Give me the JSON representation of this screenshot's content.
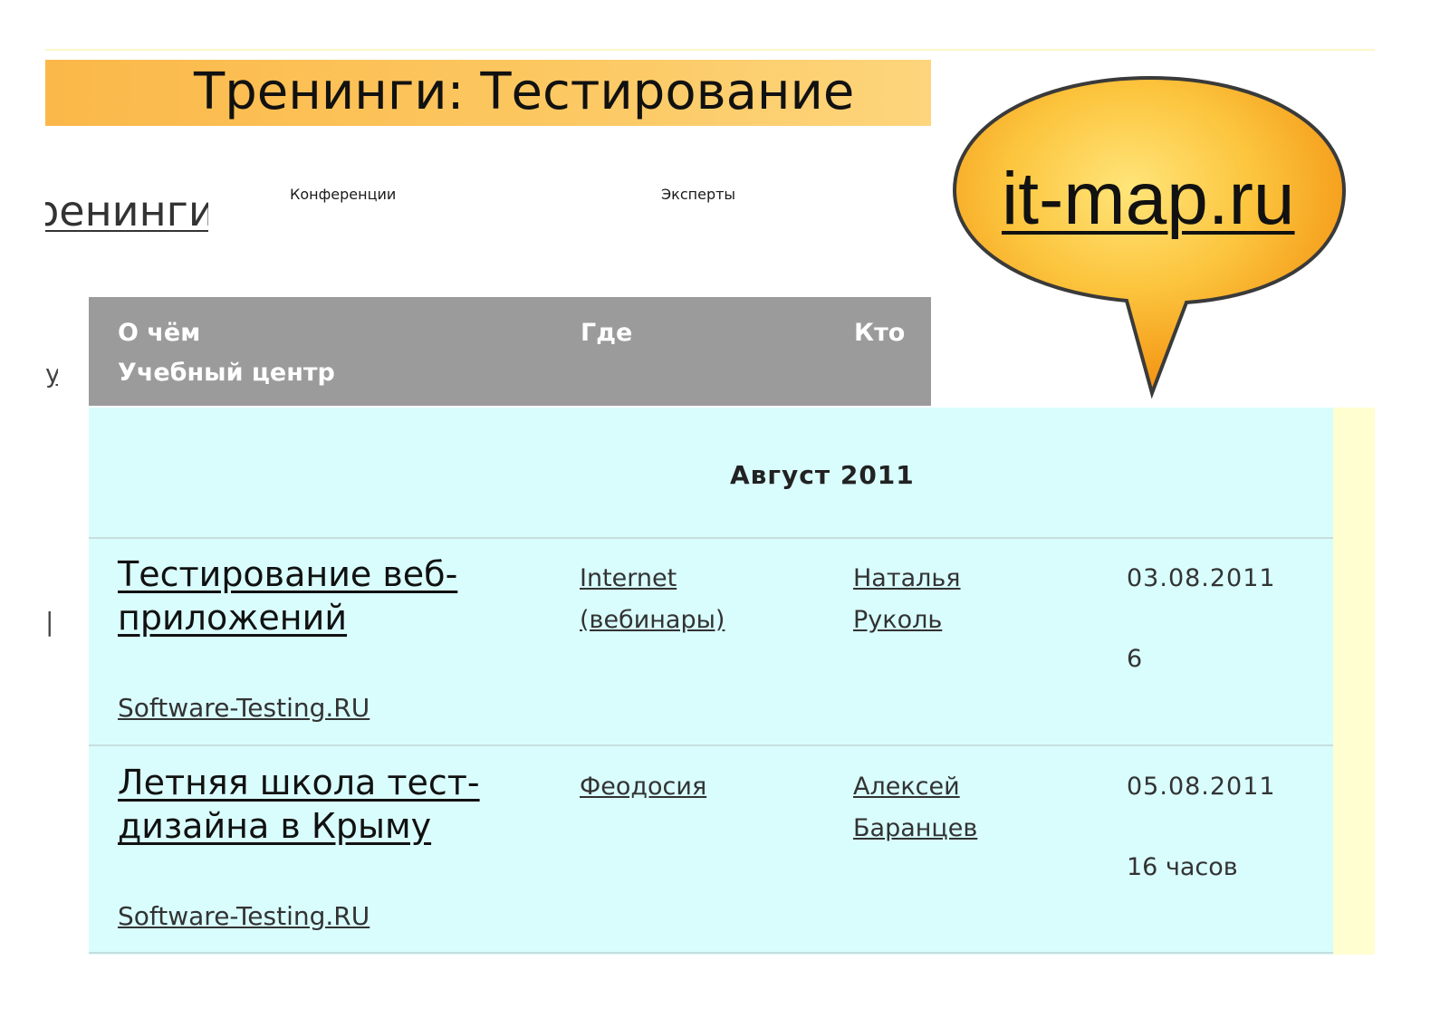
{
  "page": {
    "title": "Тренинги: Тестирование",
    "logo_text": "it-map.ru"
  },
  "nav": {
    "items": [
      {
        "label": "Тренинги"
      },
      {
        "label": "Конференции"
      },
      {
        "label": "Эксперты"
      }
    ]
  },
  "table": {
    "headers": {
      "about": "О чём",
      "center": "Учебный центр",
      "where": "Где",
      "who": "Кто"
    },
    "month": "Август 2011",
    "rows": [
      {
        "title": "Тестирование веб-приложений",
        "center": "Software-Testing.RU",
        "where": "Internet (вебинары)",
        "who": "Наталья Руколь",
        "date": "03.08.2011",
        "duration": "6"
      },
      {
        "title": "Летняя школа тест-дизайна в Крыму",
        "center": "Software-Testing.RU",
        "where": "Феодосия",
        "who": "Алексей Баранцев",
        "date": "05.08.2011",
        "duration": "16 часов"
      }
    ]
  },
  "colors": {
    "title_bar": "#fcc760",
    "header_bg": "#9b9b9b",
    "table_bg": "#d9fdfd",
    "bubble_orange": "#f59a0e",
    "bubble_light": "#ffe57a"
  }
}
